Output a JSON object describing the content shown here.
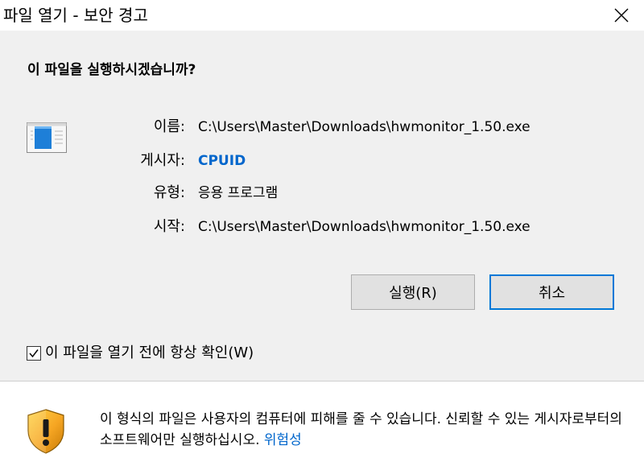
{
  "window": {
    "title": "파일 열기 - 보안 경고"
  },
  "prompt": {
    "question": "이 파일을 실행하시겠습니까?"
  },
  "file_info": {
    "name_label": "이름:",
    "name_value": "C:\\Users\\Master\\Downloads\\hwmonitor_1.50.exe",
    "publisher_label": "게시자:",
    "publisher_value": "CPUID",
    "type_label": "유형:",
    "type_value": "응용 프로그램",
    "from_label": "시작:",
    "from_value": "C:\\Users\\Master\\Downloads\\hwmonitor_1.50.exe"
  },
  "buttons": {
    "run_label": "실행(R)",
    "cancel_label": "취소"
  },
  "checkbox": {
    "label": "이 파일을 열기 전에 항상 확인(W)",
    "checked": true
  },
  "warning": {
    "text": "이 형식의 파일은 사용자의 컴퓨터에 피해를 줄 수 있습니다. 신뢰할 수 있는 게시자로부터의 소프트웨어만 실행하십시오.",
    "link": "위험성"
  },
  "icons": {
    "close": "close-icon",
    "file": "application-file-icon",
    "checkmark": "checkmark-icon",
    "shield": "warning-shield-icon"
  },
  "colors": {
    "link": "#0066cc",
    "default_button_border": "#0078d7",
    "dialog_background": "#f0f0f0"
  }
}
